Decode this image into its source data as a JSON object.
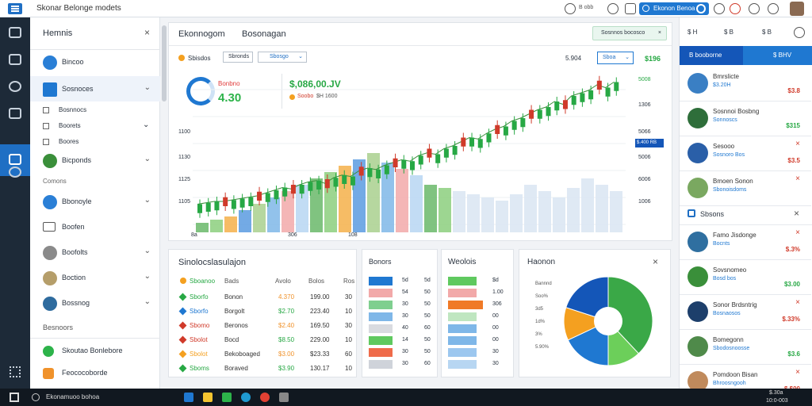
{
  "topbar": {
    "title": "Skonar Belonge modets",
    "search_label": "Ekonon Benoa",
    "colors": {
      "accent": "#1f78d1"
    }
  },
  "sidebar": {
    "header": "Hemnis",
    "items": [
      {
        "label": "Bincoo",
        "icon": "globe-icon",
        "color": "#2a7fd6"
      },
      {
        "label": "Sosnoces",
        "icon": "doc-icon",
        "color": "#1f78d1"
      },
      {
        "label": "Bosnnocs",
        "icon": "box-icon",
        "color": "#555"
      },
      {
        "label": "Boorets",
        "icon": "box-icon",
        "color": "#555"
      },
      {
        "label": "Boores",
        "icon": "box-icon",
        "color": "#555"
      },
      {
        "label": "Bicponds",
        "icon": "avatar-icon",
        "color": "#3a8f3a"
      },
      {
        "label": "Comons",
        "icon": "none",
        "color": "#666"
      },
      {
        "label": "Bbonoyle",
        "icon": "globe-icon",
        "color": "#2a7fd6"
      },
      {
        "label": "Boofen",
        "icon": "window-icon",
        "color": "#555"
      },
      {
        "label": "Boofolts",
        "icon": "coin-icon",
        "color": "#8a8a8a"
      },
      {
        "label": "Boction",
        "icon": "coin-icon",
        "color": "#b59e6a"
      },
      {
        "label": "Bossnog",
        "icon": "avatar-icon",
        "color": "#2e6b9e"
      },
      {
        "label": "Besnoors",
        "icon": "none",
        "color": "#666"
      },
      {
        "label": "Skoutao Bonlebore",
        "icon": "dot-icon",
        "color": "#2db34a"
      },
      {
        "label": "Feococoborde",
        "icon": "dot-icon",
        "color": "#f0922b"
      }
    ]
  },
  "chart_card": {
    "tab1": "Ekonnogom",
    "tab2": "Bosonagan",
    "btn": "Sosnnos bocosco",
    "sel_a": "Sbisdos",
    "sel_b": "Sbronds",
    "sel_c": "Sbosgo",
    "price_small": "5.904",
    "price_label": "Sboa",
    "price_right": "$196",
    "gauge_label": "Bonbno",
    "gauge_value": "4.30",
    "big_value": "$,086,00.JV",
    "big_sub": "Soobo",
    "big_sub2": "$H 1600",
    "yaxis": [
      "1100",
      "1130",
      "1125",
      "1105"
    ],
    "yaxis_right": [
      "5008",
      "1306",
      "5066",
      "5006",
      "6006",
      "1006"
    ],
    "xaxis": [
      "8a",
      "306",
      "108"
    ],
    "right_badge": "$.400 RB"
  },
  "chart_data": {
    "type": "candlestick",
    "series": [
      {
        "name": "price",
        "values": [
          10,
          11,
          12,
          12,
          13,
          14,
          15,
          16,
          18,
          20,
          22,
          21,
          24,
          26,
          27,
          25,
          29,
          31,
          30,
          34,
          36,
          35,
          38,
          40,
          42,
          41,
          45,
          47,
          46,
          50,
          52,
          55,
          58,
          57,
          61,
          64,
          66,
          70,
          72,
          75,
          78,
          80,
          84,
          82,
          88,
          90,
          92,
          96,
          94,
          98
        ]
      }
    ],
    "bars": [
      6,
      8,
      10,
      14,
      18,
      22,
      26,
      30,
      34,
      38,
      42,
      46,
      50,
      44,
      40,
      36,
      30,
      28,
      26,
      24,
      22,
      20,
      24,
      30,
      26,
      22,
      28,
      34,
      30,
      26
    ]
  },
  "watchlist": {
    "title": "Sinolocslasulajon",
    "head": [
      "Sboanoo",
      "Bads",
      "Avolo",
      "Bolos",
      "Ros"
    ],
    "rows": [
      {
        "sym": "Sborfo",
        "name": "Bonon",
        "a": "4.370",
        "b": "199.00",
        "c": "30"
      },
      {
        "sym": "Sborfo",
        "name": "Borgolt",
        "a": "$2.70",
        "b": "223.40",
        "c": "10"
      },
      {
        "sym": "Sbomo",
        "name": "Beronos",
        "a": "$2.40",
        "b": "169.50",
        "c": "30"
      },
      {
        "sym": "Sbolot",
        "name": "Bocd",
        "a": "$8.50",
        "b": "229.00",
        "c": "10"
      },
      {
        "sym": "Sbolot",
        "name": "Bekoboaged",
        "a": "$3.00",
        "b": "$23.33",
        "c": "60"
      },
      {
        "sym": "Sboms",
        "name": "Boraved",
        "a": "$3.90",
        "b": "130.17",
        "c": "10"
      }
    ]
  },
  "mini1": {
    "title": "Bonors",
    "cols": [
      "5d",
      "5d"
    ],
    "vals": [
      [
        "5d",
        "5d"
      ],
      [
        "54",
        "50"
      ],
      [
        "30",
        "50"
      ],
      [
        "30",
        "50"
      ],
      [
        "40",
        "60"
      ],
      [
        "14",
        "50"
      ],
      [
        "30",
        "50"
      ],
      [
        "30",
        "60"
      ]
    ],
    "colors": [
      "#1f78d1",
      "#f2a9a9",
      "#7fcf8f",
      "#7fb7e8",
      "#d9dbe0",
      "#5fc95f",
      "#ef6b4a",
      "#cfd3da"
    ]
  },
  "mini2": {
    "title": "Weolois",
    "vals": [
      "$d",
      "1.00",
      "306",
      "00",
      "00",
      "00",
      "30",
      "30"
    ],
    "colors": [
      "#5fc95f",
      "#f2a9a9",
      "#f07a27",
      "#bfe6c0",
      "#7fb7e8",
      "#7fb7e8",
      "#9cc7ef",
      "#b7d6f2"
    ]
  },
  "pie": {
    "title": "Haonon",
    "labels": [
      "Bannnd",
      "Soo%",
      "3d5",
      "1d%",
      "3%",
      "5.90%"
    ],
    "slices": [
      0.38,
      0.12,
      0.18,
      0.12,
      0.2
    ],
    "colors": [
      "#3aa847",
      "#6ccf5a",
      "#1f78d1",
      "#f4a020",
      "#1456b8"
    ]
  },
  "rpanel": {
    "header": [
      "$ H",
      "$ B",
      "$ B"
    ],
    "tab_label": "B booborne",
    "tab_value": "$ BHV",
    "rows": [
      {
        "name": "Bmrslicte",
        "sub": "$3.20H",
        "val": "$3.8",
        "x": ""
      },
      {
        "name": "Sosnnoi Bosbng",
        "sub": "Sonnoscs",
        "val": "$315",
        "x": ""
      },
      {
        "name": "Sesooo",
        "sub": "Sosnoro Bos",
        "val": "$3.5",
        "x": "×"
      },
      {
        "name": "Bmoen Sonon",
        "sub": "Sbonoisdoms",
        "val": "",
        "x": "×"
      }
    ],
    "section2": "Sbsons",
    "rows2": [
      {
        "name": "Famo Jisdonge",
        "sub": "Bocnts",
        "val": "$.3%",
        "x": "×"
      },
      {
        "name": "Sovsnomeo",
        "sub": "Bosd bos",
        "val": "$3.00",
        "x": ""
      },
      {
        "name": "Sonor Brdsntrig",
        "sub": "Bosnaosos",
        "val": "$.33%",
        "x": "×"
      },
      {
        "name": "Bomegonn",
        "sub": "Sbodosnoosse",
        "val": "$3.6",
        "x": ""
      },
      {
        "name": "Pomdoon Bisan",
        "sub": "Bhroosngooh",
        "val": "$ $00",
        "x": "×"
      }
    ]
  },
  "taskbar": {
    "search": "Ekonamuoo bohoa",
    "time": "$.30a",
    "date": "10:0-003"
  }
}
